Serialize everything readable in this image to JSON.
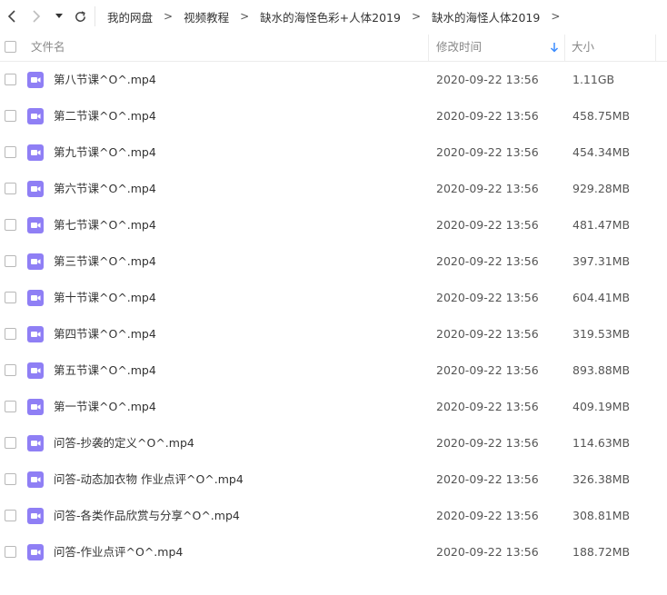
{
  "breadcrumb": [
    {
      "label": "我的网盘"
    },
    {
      "label": "视频教程"
    },
    {
      "label": "缺水的海怪色彩+人体2019"
    },
    {
      "label": "缺水的海怪人体2019"
    }
  ],
  "breadcrumb_separator": ">",
  "columns": {
    "name": "文件名",
    "mtime": "修改时间",
    "size": "大小"
  },
  "colors": {
    "video_icon": "#8f7ff5",
    "sort_arrow": "#3b8cff"
  },
  "files": [
    {
      "name": "第八节课^O^.mp4",
      "mtime": "2020-09-22 13:56",
      "size": "1.11GB",
      "icon": "video-file-icon"
    },
    {
      "name": "第二节课^O^.mp4",
      "mtime": "2020-09-22 13:56",
      "size": "458.75MB",
      "icon": "video-file-icon"
    },
    {
      "name": "第九节课^O^.mp4",
      "mtime": "2020-09-22 13:56",
      "size": "454.34MB",
      "icon": "video-file-icon"
    },
    {
      "name": "第六节课^O^.mp4",
      "mtime": "2020-09-22 13:56",
      "size": "929.28MB",
      "icon": "video-file-icon"
    },
    {
      "name": "第七节课^O^.mp4",
      "mtime": "2020-09-22 13:56",
      "size": "481.47MB",
      "icon": "video-file-icon"
    },
    {
      "name": "第三节课^O^.mp4",
      "mtime": "2020-09-22 13:56",
      "size": "397.31MB",
      "icon": "video-file-icon"
    },
    {
      "name": "第十节课^O^.mp4",
      "mtime": "2020-09-22 13:56",
      "size": "604.41MB",
      "icon": "video-file-icon"
    },
    {
      "name": "第四节课^O^.mp4",
      "mtime": "2020-09-22 13:56",
      "size": "319.53MB",
      "icon": "video-file-icon"
    },
    {
      "name": "第五节课^O^.mp4",
      "mtime": "2020-09-22 13:56",
      "size": "893.88MB",
      "icon": "video-file-icon"
    },
    {
      "name": "第一节课^O^.mp4",
      "mtime": "2020-09-22 13:56",
      "size": "409.19MB",
      "icon": "video-file-icon"
    },
    {
      "name": "问答-抄袭的定义^O^.mp4",
      "mtime": "2020-09-22 13:56",
      "size": "114.63MB",
      "icon": "video-file-icon"
    },
    {
      "name": "问答-动态加衣物 作业点评^O^.mp4",
      "mtime": "2020-09-22 13:56",
      "size": "326.38MB",
      "icon": "video-file-icon"
    },
    {
      "name": "问答-各类作品欣赏与分享^O^.mp4",
      "mtime": "2020-09-22 13:56",
      "size": "308.81MB",
      "icon": "video-file-icon"
    },
    {
      "name": "问答-作业点评^O^.mp4",
      "mtime": "2020-09-22 13:56",
      "size": "188.72MB",
      "icon": "video-file-icon"
    }
  ]
}
